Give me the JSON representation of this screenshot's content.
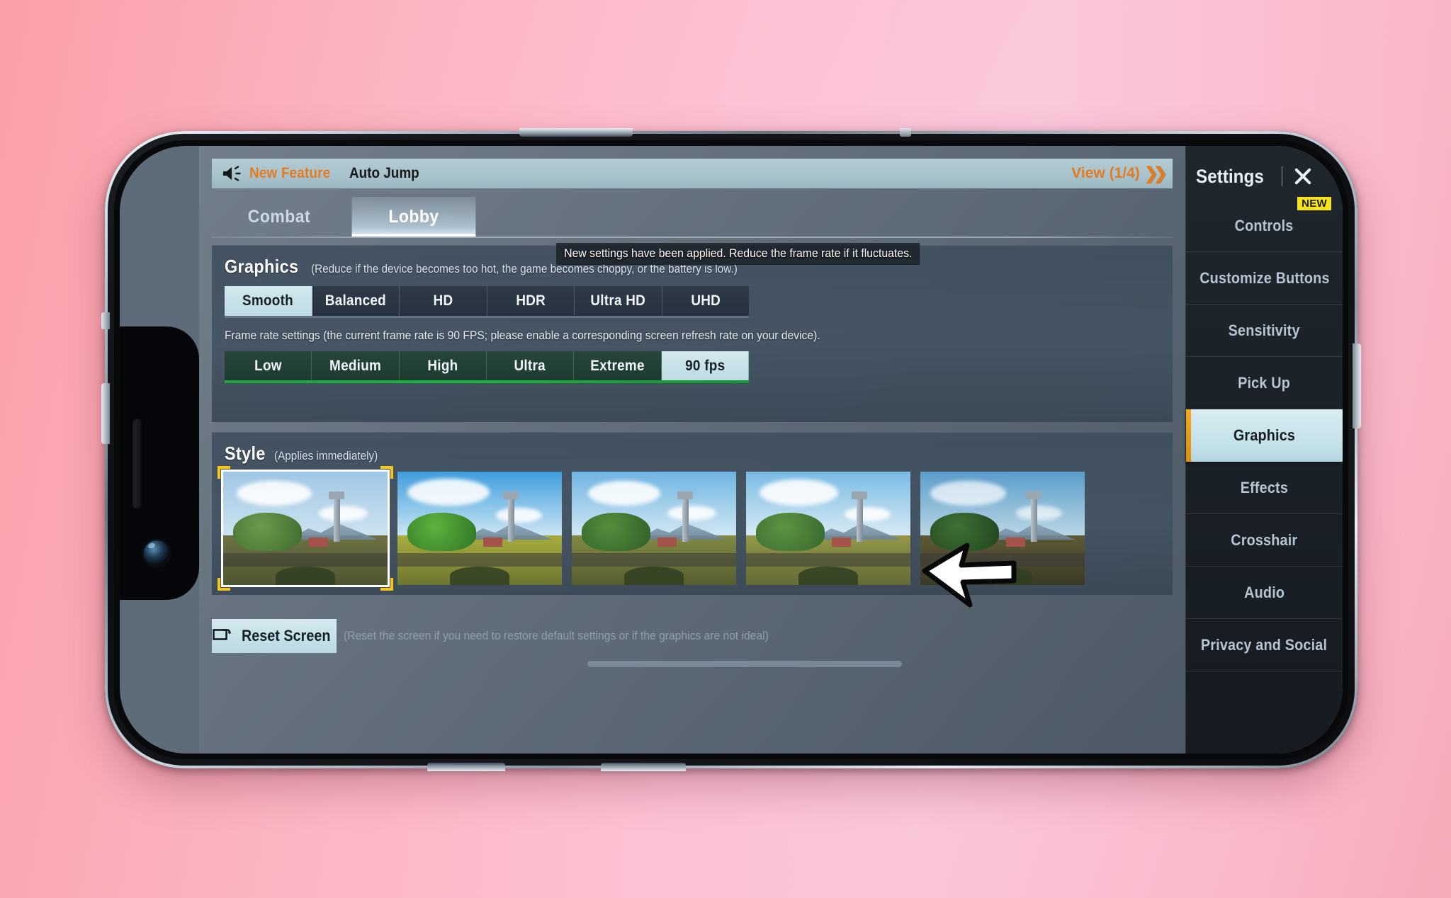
{
  "announce": {
    "icon": "speaker-icon",
    "label": "New Feature",
    "title": "Auto Jump",
    "view": "View (1/4)",
    "chevron": "chevron-double-right-icon"
  },
  "tabs": [
    {
      "label": "Combat",
      "active": false
    },
    {
      "label": "Lobby",
      "active": true
    }
  ],
  "toast": "New settings have been applied. Reduce the frame rate if it fluctuates.",
  "graphics": {
    "title": "Graphics",
    "subtitle": "(Reduce if the device becomes too hot, the game becomes choppy, or the battery is low.)",
    "quality_options": [
      {
        "label": "Smooth",
        "selected": true
      },
      {
        "label": "Balanced",
        "selected": false
      },
      {
        "label": "HD",
        "selected": false
      },
      {
        "label": "HDR",
        "selected": false
      },
      {
        "label": "Ultra HD",
        "selected": false
      },
      {
        "label": "UHD",
        "selected": false
      }
    ],
    "framerate_hint": "Frame rate settings (the current frame rate is 90 FPS; please enable a corresponding screen refresh rate on your device).",
    "framerate_options": [
      {
        "label": "Low",
        "selected": false
      },
      {
        "label": "Medium",
        "selected": false
      },
      {
        "label": "High",
        "selected": false
      },
      {
        "label": "Ultra",
        "selected": false
      },
      {
        "label": "Extreme",
        "selected": false
      },
      {
        "label": "90 fps",
        "selected": true
      }
    ]
  },
  "style": {
    "title": "Style",
    "subtitle": "(Applies immediately)",
    "thumbnails": [
      {
        "name": "classic",
        "selected": true,
        "sky_top": "#9fc7e6",
        "sky_bottom": "#cfe3ef",
        "ground": "#6d7243",
        "tree": "#4e7a3a"
      },
      {
        "name": "colorful",
        "selected": false,
        "sky_top": "#4ba3de",
        "sky_bottom": "#cfe8f4",
        "ground": "#9aa13c",
        "tree": "#3f8a2e"
      },
      {
        "name": "realistic",
        "selected": false,
        "sky_top": "#6fb4e2",
        "sky_bottom": "#d4e9f3",
        "ground": "#7d8442",
        "tree": "#3b6f31"
      },
      {
        "name": "soft",
        "selected": false,
        "sky_top": "#79bbe4",
        "sky_bottom": "#dbecf4",
        "ground": "#8d9147",
        "tree": "#46793a"
      },
      {
        "name": "movie",
        "selected": false,
        "sky_top": "#5a9ccb",
        "sky_bottom": "#bcd8e6",
        "ground": "#5e5a37",
        "tree": "#2c5a2c"
      }
    ]
  },
  "reset": {
    "icon": "reset-screen-icon",
    "label": "Reset Screen",
    "note": "(Reset the screen if you need to restore default settings or if the graphics are not ideal)"
  },
  "sidebar": {
    "title": "Settings",
    "close_icon": "close-icon",
    "items": [
      {
        "label": "Controls",
        "active": false,
        "badge": "NEW"
      },
      {
        "label": "Customize Buttons",
        "active": false,
        "badge": ""
      },
      {
        "label": "Sensitivity",
        "active": false,
        "badge": ""
      },
      {
        "label": "Pick Up",
        "active": false,
        "badge": ""
      },
      {
        "label": "Graphics",
        "active": true,
        "badge": ""
      },
      {
        "label": "Effects",
        "active": false,
        "badge": ""
      },
      {
        "label": "Crosshair",
        "active": false,
        "badge": ""
      },
      {
        "label": "Audio",
        "active": false,
        "badge": ""
      },
      {
        "label": "Privacy and Social",
        "active": false,
        "badge": ""
      }
    ]
  },
  "cursor": {
    "icon": "arrow-cursor-left-icon"
  },
  "colors": {
    "accent_orange": "#e27b22",
    "selected_blue": "#c3e0e8",
    "framerate_green": "#19b53c",
    "badge_yellow": "#f6e31c",
    "active_bar_gold": "#f0a81e"
  }
}
